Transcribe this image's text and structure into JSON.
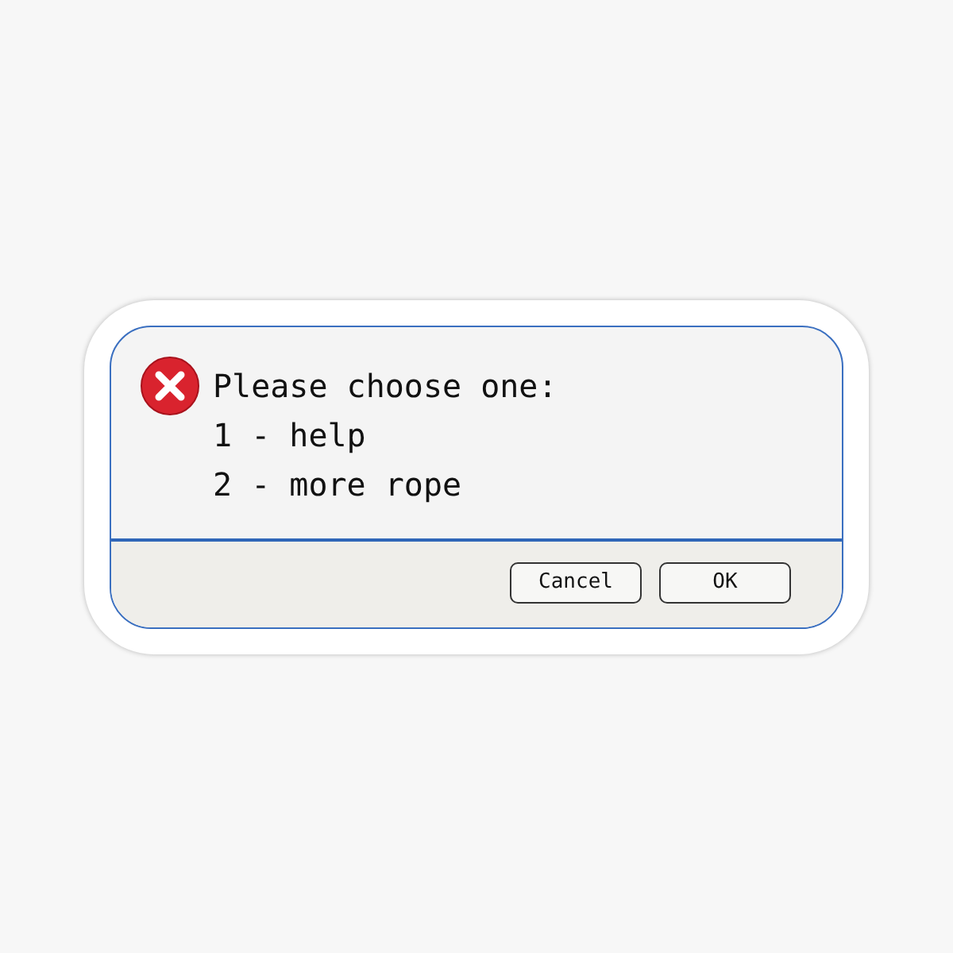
{
  "dialog": {
    "message_lines": [
      "Please choose one:",
      "1 - help",
      "2 - more rope"
    ],
    "buttons": [
      "Cancel",
      "OK"
    ]
  }
}
